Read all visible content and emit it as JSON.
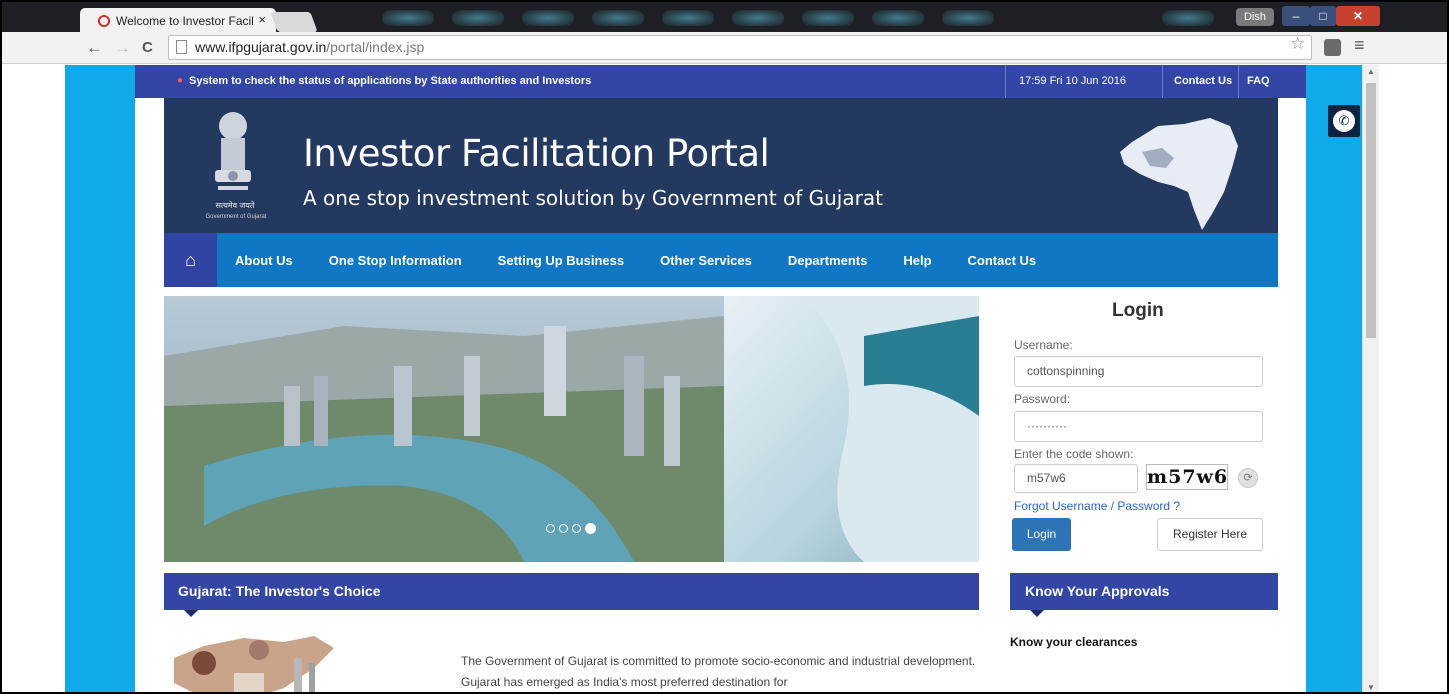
{
  "browser": {
    "tab_title": "Welcome to Investor Facil",
    "tab_close": "×",
    "user_label": "Dish",
    "win_min": "–",
    "win_max": "□",
    "win_close": "✕",
    "url_host": "www.ifpgujarat.gov.in",
    "url_path": "/portal/index.jsp",
    "back": "←",
    "forward": "→",
    "reload": "C",
    "star": "☆",
    "menu": "≡"
  },
  "topstrip": {
    "ticker": "System to check the status of applications by State authorities and Investors",
    "datetime": "17:59  Fri  10 Jun 2016",
    "contact": "Contact Us",
    "faq": "FAQ"
  },
  "banner": {
    "title": "Investor Facilitation Portal",
    "subtitle": "A one stop investment solution by Government of Gujarat",
    "emblem_caption": "सत्यमेव जयते",
    "emblem_caption2": "Government of Gujarat"
  },
  "nav": {
    "home_icon": "⌂",
    "items": [
      "About Us",
      "One Stop Information",
      "Setting Up Business",
      "Other Services",
      "Departments",
      "Help",
      "Contact Us"
    ]
  },
  "slider": {
    "slides": 4,
    "active_slide": 4
  },
  "login": {
    "title": "Login",
    "username_label": "Username:",
    "username_value": "cottonspinning",
    "password_label": "Password:",
    "password_value": "··········",
    "code_label": "Enter the code shown:",
    "code_value": "m57w6",
    "captcha_text": "m57w6",
    "refresh_icon": "⟳",
    "forgot": "Forgot Username / Password ?",
    "login_button": "Login",
    "register_button": "Register Here"
  },
  "sections": {
    "choice_title": "Gujarat: The Investor's Choice",
    "approvals_title": "Know Your Approvals",
    "clearances": "Know your clearances",
    "intro_text": "The Government of Gujarat is committed to promote socio-economic and industrial development. Gujarat has emerged as India's most preferred destination for"
  },
  "phone_icon": "✆",
  "colors": {
    "side": "#10a9ea",
    "strip": "#3346a6",
    "banner": "#233960",
    "nav": "#1077c4"
  }
}
